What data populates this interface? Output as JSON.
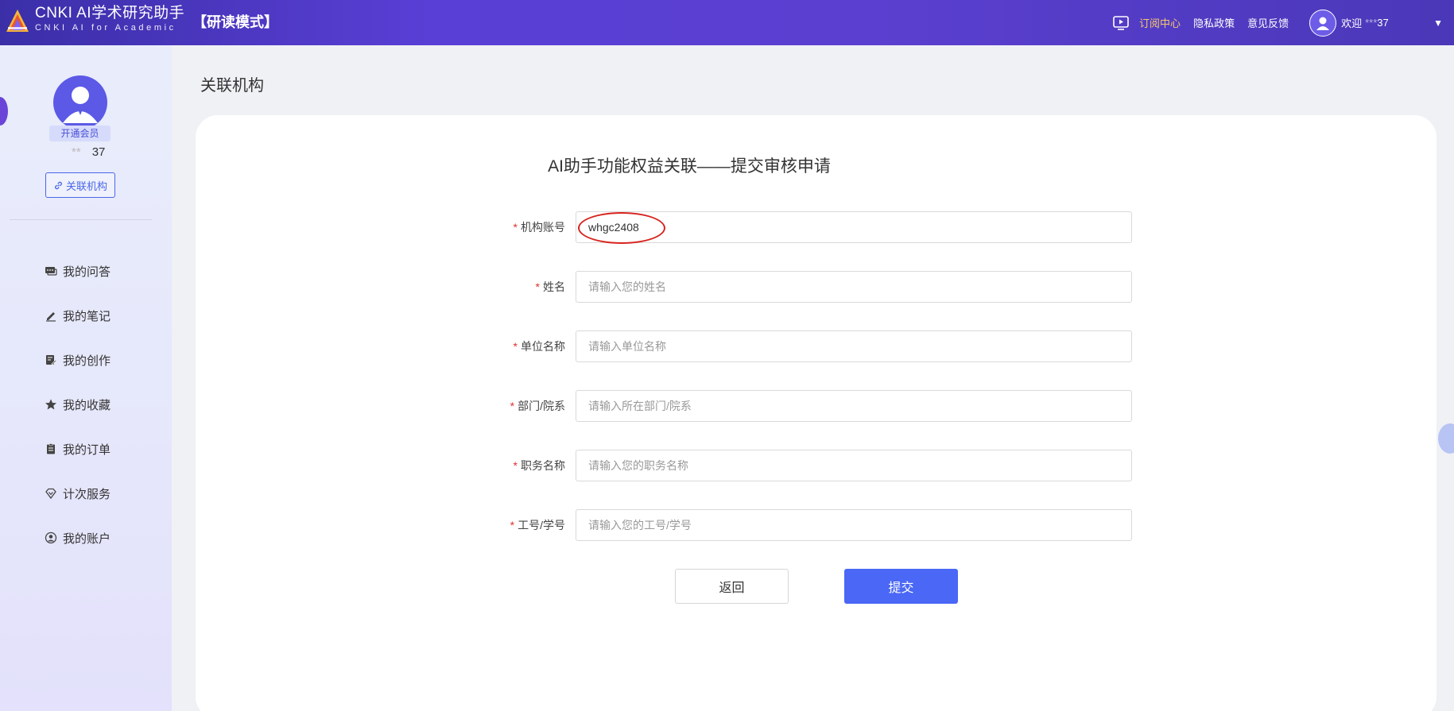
{
  "header": {
    "brand_title": "CNKI AI学术研究助手",
    "brand_subtitle": "CNKI AI for Academic",
    "mode": "【研读模式】",
    "links": {
      "subscribe": "订阅中心",
      "privacy": "隐私政策",
      "feedback": "意见反馈"
    },
    "welcome": "欢迎",
    "user_masked": "***",
    "user_suffix": "37",
    "accent_color": "#f5c86b"
  },
  "sidebar": {
    "member_badge": "开通会员",
    "user_masked": "**",
    "user_suffix": "37",
    "link_org_button": "关联机构",
    "menu": [
      {
        "label": "我的问答",
        "icon": "chat-icon"
      },
      {
        "label": "我的笔记",
        "icon": "pen-icon"
      },
      {
        "label": "我的创作",
        "icon": "edit-doc-icon"
      },
      {
        "label": "我的收藏",
        "icon": "star-icon"
      },
      {
        "label": "我的订单",
        "icon": "clipboard-icon"
      },
      {
        "label": "计次服务",
        "icon": "diamond-icon"
      },
      {
        "label": "我的账户",
        "icon": "user-circle-icon"
      }
    ]
  },
  "main": {
    "page_title": "关联机构",
    "form_title": "AI助手功能权益关联——提交审核申请",
    "fields": [
      {
        "label": "机构账号",
        "value": "whgc2408",
        "placeholder": ""
      },
      {
        "label": "姓名",
        "value": "",
        "placeholder": "请输入您的姓名"
      },
      {
        "label": "单位名称",
        "value": "",
        "placeholder": "请输入单位名称"
      },
      {
        "label": "部门/院系",
        "value": "",
        "placeholder": "请输入所在部门/院系"
      },
      {
        "label": "职务名称",
        "value": "",
        "placeholder": "请输入您的职务名称"
      },
      {
        "label": "工号/学号",
        "value": "",
        "placeholder": "请输入您的工号/学号"
      }
    ],
    "required_mark": "*",
    "back_button": "返回",
    "submit_button": "提交",
    "primary_color": "#4a67f5"
  }
}
